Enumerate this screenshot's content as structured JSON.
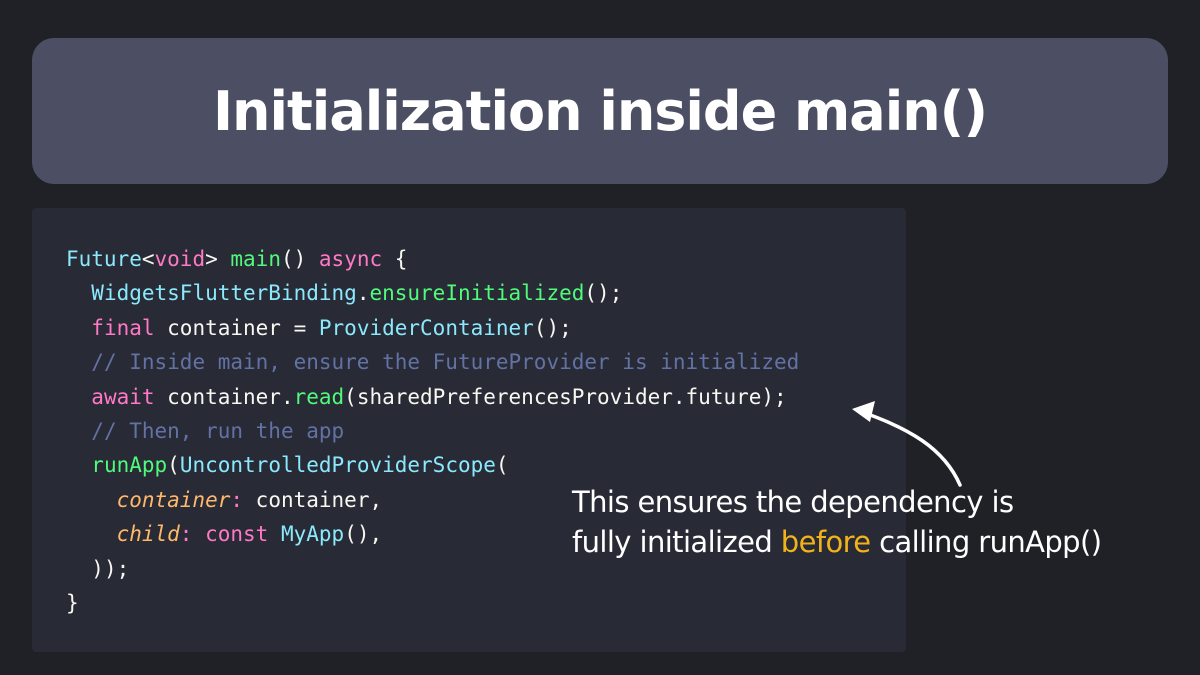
{
  "title": "Initialization inside main()",
  "code": {
    "line1": {
      "t1": "Future",
      "p1": "<",
      "k1": "void",
      "p2": "> ",
      "f1": "main",
      "p3": "() ",
      "k2": "async",
      "p4": " {"
    },
    "line2": {
      "indent": "  ",
      "t1": "WidgetsFlutterBinding",
      "p1": ".",
      "f1": "ensureInitialized",
      "p2": "();"
    },
    "line3": {
      "indent": "  ",
      "k1": "final",
      "p1": " container = ",
      "t1": "ProviderContainer",
      "p2": "();"
    },
    "line4": {
      "indent": "  ",
      "c1": "// Inside main, ensure the FutureProvider is initialized"
    },
    "line5": {
      "indent": "  ",
      "k1": "await",
      "p1": " container.",
      "f1": "read",
      "p2": "(sharedPreferencesProvider.future);"
    },
    "line6": {
      "indent": "  ",
      "c1": "// Then, run the app"
    },
    "line7": {
      "indent": "  ",
      "f1": "runApp",
      "p1": "(",
      "t1": "UncontrolledProviderScope",
      "p2": "("
    },
    "line8": {
      "indent": "    ",
      "n1": "container",
      "k1": ":",
      "p1": " container,"
    },
    "line9": {
      "indent": "    ",
      "n1": "child",
      "k1": ":",
      "p1": " ",
      "k2": "const",
      "p2": " ",
      "t1": "MyApp",
      "p3": "(),"
    },
    "line10": {
      "indent": "  ",
      "p1": "));"
    },
    "line11": {
      "p1": "}"
    }
  },
  "annotation": {
    "line1": "This ensures the dependency is",
    "line2_start": "fully initialized ",
    "highlight": "before",
    "line2_end": " calling runApp()",
    "highlight_color": "#f2b21a"
  },
  "colors": {
    "background": "#202027",
    "title_bar": "#4c4e63",
    "code_panel": "#282a35",
    "keyword": "#ff79c6",
    "type": "#8be9fd",
    "function": "#50fa7b",
    "comment": "#6272a4",
    "named_param": "#ffb86c"
  }
}
